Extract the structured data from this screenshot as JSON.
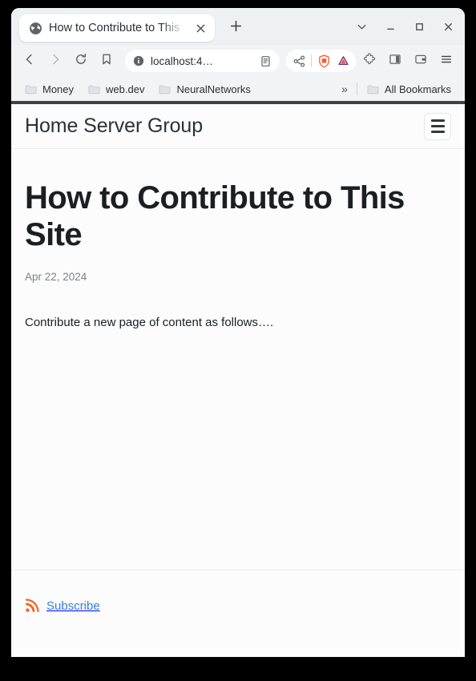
{
  "browser": {
    "name": "Brave",
    "tab": {
      "favicon": "globe-icon",
      "title": "How to Contribute to This Site",
      "close_label": "×"
    },
    "new_tab_label": "+",
    "window_controls": [
      {
        "name": "tab-search",
        "label": "⌄"
      },
      {
        "name": "minimize",
        "label": "–"
      },
      {
        "name": "maximize",
        "label": "□"
      },
      {
        "name": "close",
        "label": "×"
      }
    ],
    "toolbar": {
      "back_label": "Back",
      "forward_label": "Forward",
      "reload_label": "Reload",
      "bookmark_label": "Bookmark this tab",
      "url": "localhost:4…",
      "site_info_label": "View site information",
      "reading_list_label": "Reading list",
      "share_label": "Share this page",
      "shields_label": "Brave Shields",
      "rewards_label": "Brave Rewards",
      "extensions_label": "Extensions",
      "sidebar_label": "Show sidebar",
      "wallet_label": "Brave Wallet",
      "menu_label": "Customize and control Brave"
    },
    "bookmarks": {
      "items": [
        {
          "icon": "folder-icon",
          "label": "Money"
        },
        {
          "icon": "folder-icon",
          "label": "web.dev"
        },
        {
          "icon": "folder-icon",
          "label": "NeuralNetworks"
        }
      ],
      "overflow_label": "»",
      "all_bookmarks": {
        "icon": "folder-icon",
        "label": "All Bookmarks"
      }
    }
  },
  "page": {
    "header": {
      "site_title": "Home Server Group",
      "menu_button_label": "Menu"
    },
    "post": {
      "title": "How to Contribute to This Site",
      "date": "Apr 22, 2024",
      "body": "Contribute a new page of content as follows…."
    },
    "footer": {
      "subscribe_icon": "rss-icon",
      "subscribe_label": "Subscribe"
    }
  },
  "colors": {
    "brave_orange": "#fb542b",
    "bat_purple": "#662d91",
    "rss_orange": "#f26522",
    "link_blue": "#2f7fe0",
    "header_rule": "#3f4245",
    "chrome_bg": "#f1f3f5",
    "page_bg": "#fcfcfc"
  }
}
